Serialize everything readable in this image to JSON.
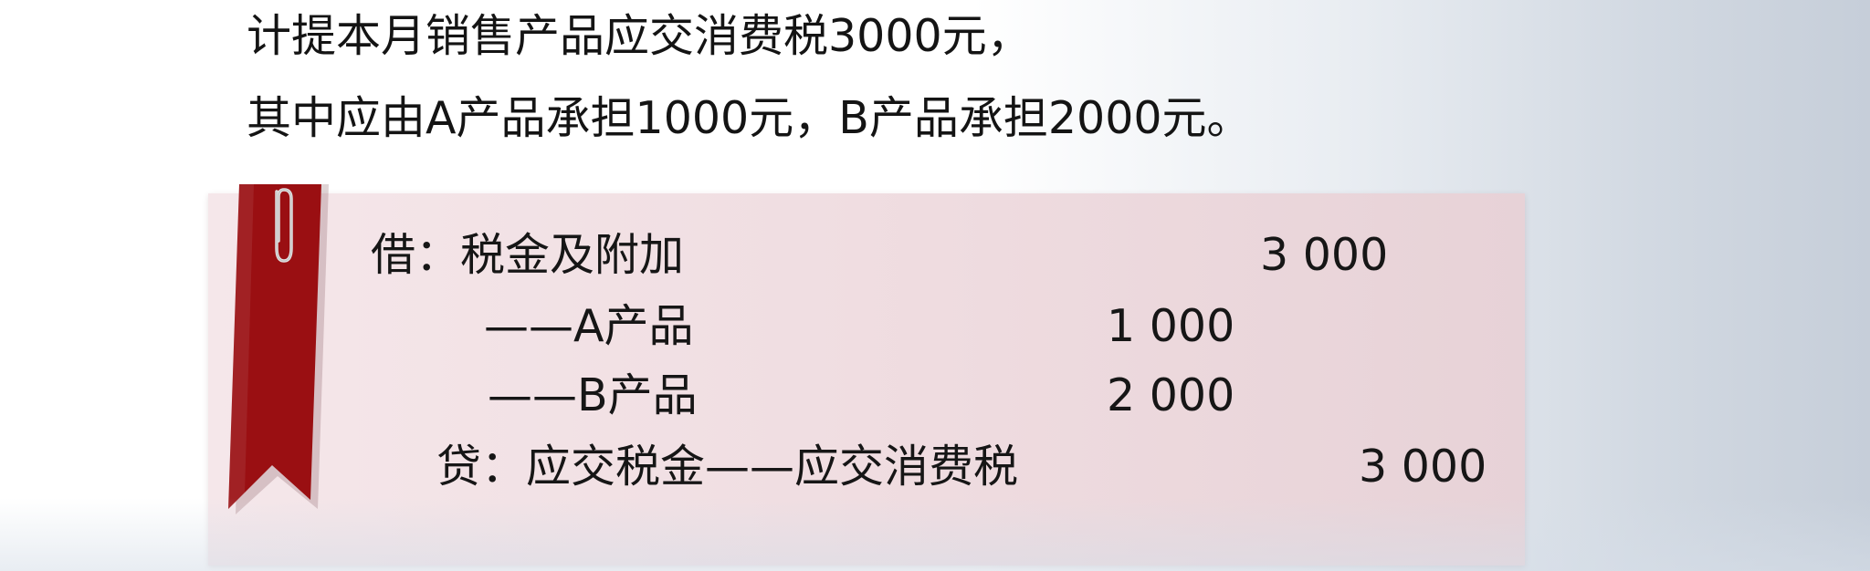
{
  "problem": {
    "line1": "计提本月销售产品应交消费税3000元，",
    "line2": "其中应由A产品承担1000元，B产品承担2000元。"
  },
  "journal_entry": {
    "debit": {
      "label": "借：税金及附加",
      "amount": "3 000",
      "sub_items": [
        {
          "label": "——A产品",
          "amount": "1 000"
        },
        {
          "label": "——B产品",
          "amount": "2 000"
        }
      ]
    },
    "credit": {
      "label": "贷：应交税金——应交消费税",
      "amount": "3 000"
    }
  },
  "colors": {
    "ribbon": "#9a0f12",
    "card_background": "#f2e2e5",
    "paperclip": "#d9d9d9"
  },
  "icons": {
    "ribbon": "bookmark-ribbon-icon",
    "clip": "paperclip-icon"
  }
}
